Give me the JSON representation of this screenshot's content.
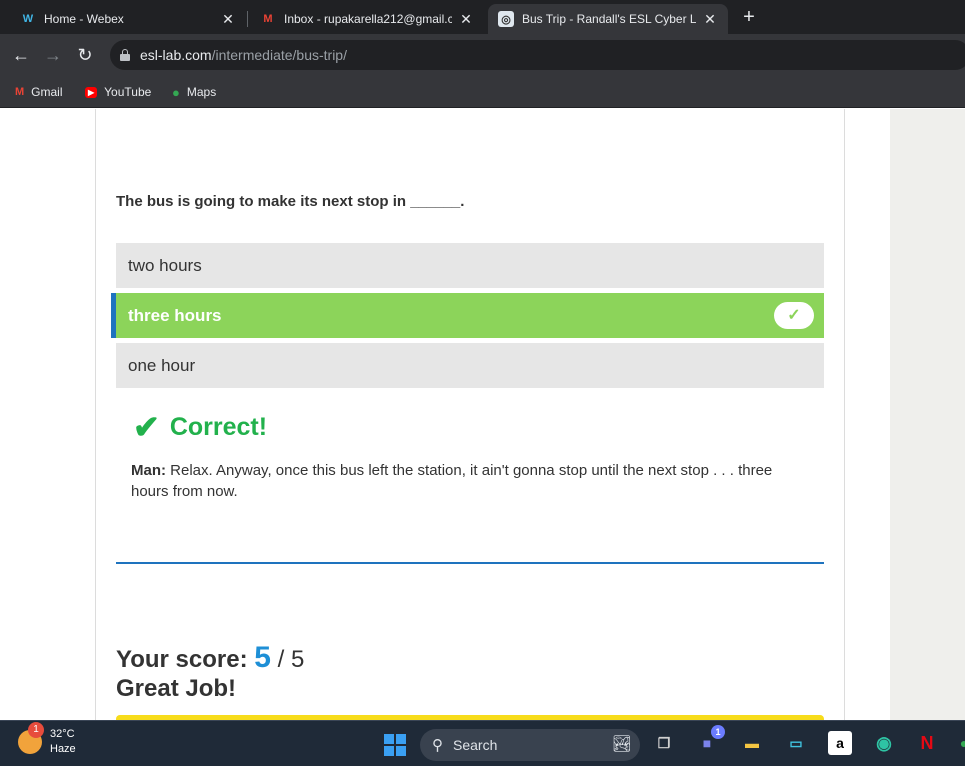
{
  "tabs": [
    {
      "title": "Home - Webex",
      "favicon": "webex-icon",
      "active": false
    },
    {
      "title": "Inbox - rupakarella212@gmail.c",
      "favicon": "gmail-icon",
      "active": false
    },
    {
      "title": "Bus Trip - Randall's ESL Cyber Lis",
      "favicon": "esl-lab-icon",
      "active": true
    }
  ],
  "close_glyph": "✕",
  "newtab_glyph": "+",
  "address": {
    "domain": "esl-lab.com",
    "path": "/intermediate/bus-trip/"
  },
  "bookmarks": [
    {
      "label": "Gmail",
      "icon": "gmail-icon"
    },
    {
      "label": "YouTube",
      "icon": "youtube-icon"
    },
    {
      "label": "Maps",
      "icon": "maps-icon"
    }
  ],
  "quiz": {
    "question": "The bus is going to make its next stop in ______.",
    "answers": [
      {
        "label": "two hours",
        "correct": false
      },
      {
        "label": "three hours",
        "correct": true
      },
      {
        "label": "one hour",
        "correct": false
      }
    ],
    "feedback_title": "Correct!",
    "feedback_speaker": "Man:",
    "feedback_text": "Relax. Anyway, once this bus left the station, it ain't gonna stop until the next stop . . . three hours from now.",
    "score_label": "Your score:",
    "score_value": "5",
    "score_total": "/ 5",
    "score_message": "Great Job!"
  },
  "taskbar": {
    "weather_temp": "32°C",
    "weather_desc": "Haze",
    "weather_badge": "1",
    "search_placeholder": "Search",
    "teams_badge": "1"
  },
  "colors": {
    "correct_green": "#8cd45a",
    "feedback_green": "#22b14c",
    "accent_blue": "#1e73be",
    "score_blue": "#1e8fd6"
  }
}
